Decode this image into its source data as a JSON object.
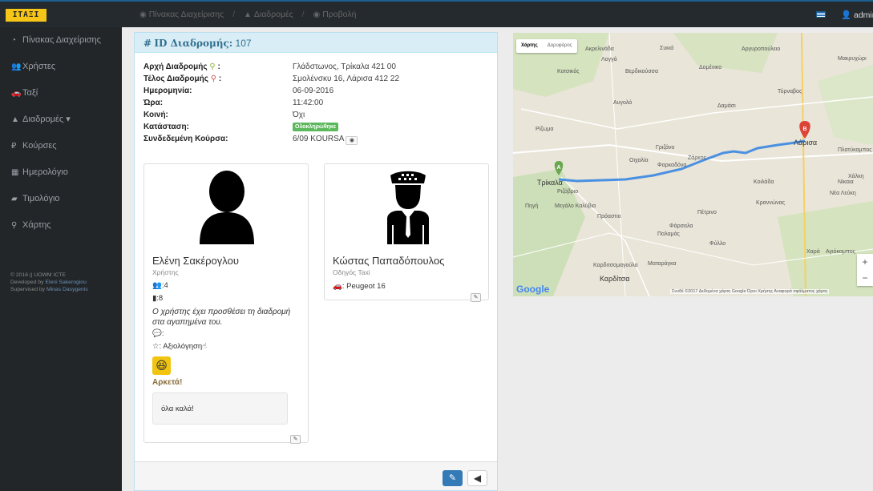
{
  "header": {
    "brand": "ITΑΞΙ",
    "breadcrumb": [
      "Πίνακας Διαχείρισης",
      "Διαδρομές",
      "Προβολή"
    ],
    "user": "admin"
  },
  "sidebar": {
    "items": [
      {
        "label": "Πίνακας Διαχείρισης",
        "icon": "dashboard-icon"
      },
      {
        "label": "Χρήστες",
        "icon": "users-icon"
      },
      {
        "label": "Ταξί",
        "icon": "car-icon"
      },
      {
        "label": "Διαδρομές",
        "icon": "road-icon"
      },
      {
        "label": "Κούρσες",
        "icon": "ruble-icon"
      },
      {
        "label": "Ημερολόγιο",
        "icon": "calendar-icon"
      },
      {
        "label": "Τιμολόγιο",
        "icon": "invoice-icon"
      },
      {
        "label": "Χάρτης",
        "icon": "map-marker-icon"
      }
    ],
    "footer": {
      "line1": "© 2016 || UOWM ICTE",
      "line2_prefix": "Developed by",
      "line2_name": "Eleni Sakerogiou",
      "line3_prefix": "Supervised by",
      "line3_name": "Minas Dasygenis"
    }
  },
  "route": {
    "heading_label": "ID Διαδρομής:",
    "id": "107",
    "fields": [
      {
        "label": "Αρχή Διαδρομής",
        "value": "Γλάδστωνος, Τρίκαλα 421 00"
      },
      {
        "label": "Τέλος Διαδρομής",
        "value": "Σμολένσκυ 16, Λάρισα 412 22"
      },
      {
        "label": "Ημερομηνία:",
        "value": "06-09-2016"
      },
      {
        "label": "Ώρα:",
        "value": "11:42:00"
      },
      {
        "label": "Κοινή:",
        "value": "Όχι"
      },
      {
        "label": "Κατάσταση:",
        "value": "Ολοκληρώθηκε"
      },
      {
        "label": "Συνδεδεμένη Κούρσα:",
        "value": "6/09 KOURSA"
      }
    ]
  },
  "user_card": {
    "name": "Ελένη Σακέρογλου",
    "role": "Χρήστης",
    "people": ":4",
    "bags": ":8",
    "note": "Ο χρήστης έχει προσθέσει τη διαδρομή στα αγαπημένα του.",
    "comment_count": ":",
    "rating_label": ": Αξιολόγηση",
    "rating_word": "Αρκετά!",
    "comment": "όλα καλά!"
  },
  "driver_card": {
    "name": "Κώστας Παπαδόπουλος",
    "role": "Οδηγός Taxi",
    "car": ": Peugeot 16"
  },
  "map": {
    "tab_map": "Χάρτης",
    "tab_sat": "Δορυφόρος",
    "logo": "Google",
    "attribution": "Συνθέ ©2017 Δεδομένα χάρτη Google  Όροι Χρήσης  Αναφορά σφάλματος χάρτη",
    "markers": [
      "A",
      "B"
    ],
    "places": [
      "Τρίκαλα",
      "Λάρισα",
      "Καρδίτσα",
      "Φάρσαλα",
      "Ρίζωμα",
      "Οιχαλία",
      "Φαρκαδόνα",
      "Γριζάνο",
      "Ζάρκος",
      "Κοιλάδα",
      "Κραννώνας",
      "Πέτρινο",
      "Παλαμάς",
      "Πρόαστιο",
      "Μεγάλο Καλύβια",
      "Ριζόβριο",
      "Πηγή",
      "Κοτσικός",
      "Αυγολά",
      "Τύρναβος",
      "Βερδικούσσα",
      "Δομένικο",
      "Συκιά",
      "Αργυροπούλειο",
      "Ακρελινάδα",
      "Δαμάσι",
      "Λογγά",
      "Νίκαια",
      "Νέα Λεύκη",
      "Μακρυχώρι",
      "Πλατύκαμπος",
      "Χάλκη",
      "Ματαράγκα",
      "Καρδιτσομαγούλα",
      "Φύλλο",
      "Χαρά",
      "Αγιόκαμπος"
    ]
  },
  "colors": {
    "route": "#4a90e2",
    "primary": "#337ab7",
    "success": "#5cb85c",
    "panel_head_bg": "#d9edf7",
    "sidebar_bg": "#222629"
  }
}
